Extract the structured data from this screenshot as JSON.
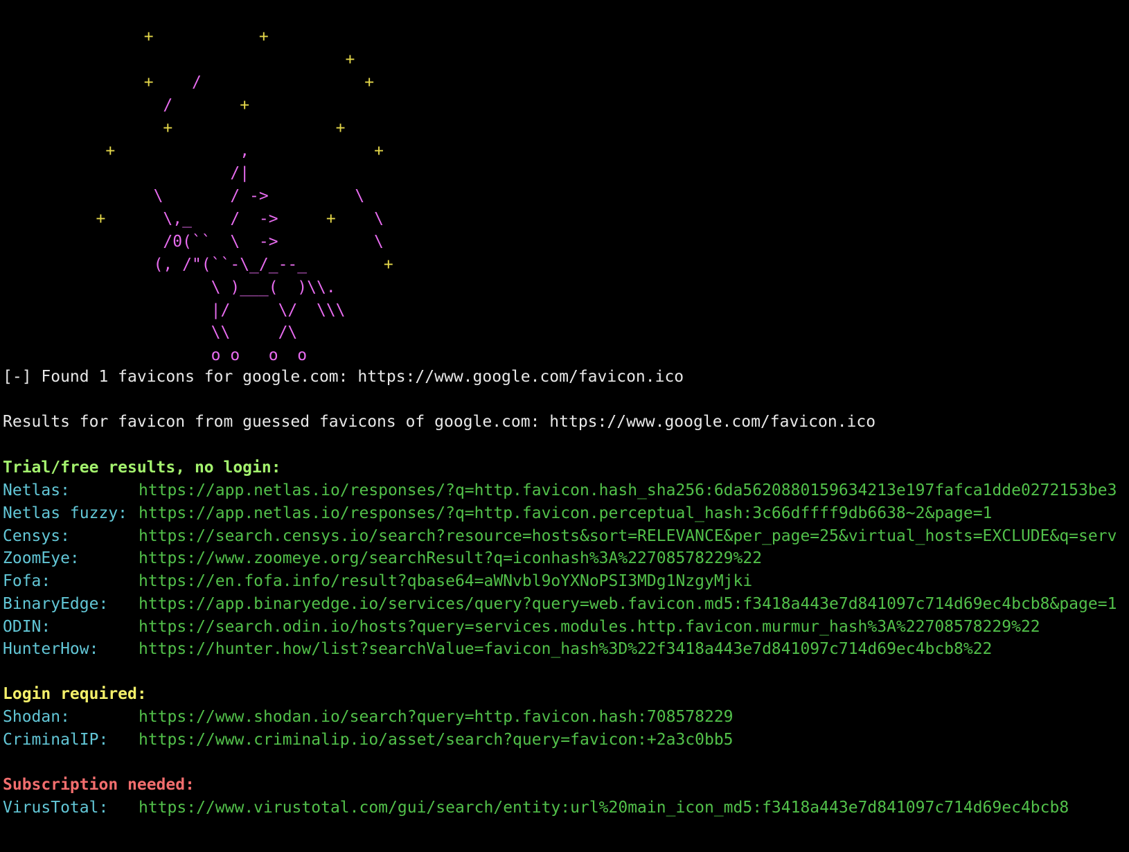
{
  "colors": {
    "background": "#000000",
    "star": "#e5d84a",
    "art": "#e86cf0",
    "text": "#e8e8e8",
    "label": "#62c6d6",
    "url": "#52c04a",
    "header_trial": "#a4f26e",
    "header_login": "#f4f06a",
    "header_subscription": "#f26e6e"
  },
  "ascii_art": {
    "lines": [
      {
        "star": "         +           +",
        "art": ""
      },
      {
        "star": "                              +",
        "art": ""
      },
      {
        "star": "         +    ",
        "art": "/",
        "star2": "                 +"
      },
      {
        "star": "",
        "art": "           /",
        "star2": "       +"
      },
      {
        "star": "           +                 +",
        "art": ""
      },
      {
        "star": "     +",
        "art": "             ,",
        "star2": "             +"
      },
      {
        "star": "",
        "art": "                  /|",
        "star2": ""
      },
      {
        "star": "",
        "art": "          \\       / ->         \\",
        "star2": ""
      },
      {
        "star": "    +",
        "art": "      \\,_    /  ->",
        "star2": "     +    ",
        "art2": "\\"
      },
      {
        "star": "",
        "art": "           /0(``  \\  ->          \\",
        "star2": ""
      },
      {
        "star": "",
        "art": "          (, /\"(``-\\_/_--_",
        "star2": "        +"
      },
      {
        "star": "",
        "art": "                \\ )___(  )\\\\.",
        "star2": ""
      },
      {
        "star": "",
        "art": "                |/     \\/  \\\\\\",
        "star2": ""
      },
      {
        "star": "",
        "art": "                \\\\     /\\",
        "star2": ""
      },
      {
        "star": "",
        "art": "                o o   o  o",
        "star2": ""
      }
    ]
  },
  "found_line": "[-] Found 1 favicons for google.com: https://www.google.com/favicon.ico",
  "results_line": "Results for favicon from guessed favicons of google.com: https://www.google.com/favicon.ico",
  "sections": [
    {
      "header": "Trial/free results, no login:",
      "entries": [
        {
          "label": "Netlas:",
          "url": "https://app.netlas.io/responses/?q=http.favicon.hash_sha256:6da5620880159634213e197fafca1dde0272153be3"
        },
        {
          "label": "Netlas fuzzy:",
          "url": "https://app.netlas.io/responses/?q=http.favicon.perceptual_hash:3c66dffff9db6638~2&page=1"
        },
        {
          "label": "Censys:",
          "url": "https://search.censys.io/search?resource=hosts&sort=RELEVANCE&per_page=25&virtual_hosts=EXCLUDE&q=serv"
        },
        {
          "label": "ZoomEye:",
          "url": "https://www.zoomeye.org/searchResult?q=iconhash%3A%22708578229%22"
        },
        {
          "label": "Fofa:",
          "url": "https://en.fofa.info/result?qbase64=aWNvbl9oYXNoPSI3MDg1NzgyMjki"
        },
        {
          "label": "BinaryEdge:",
          "url": "https://app.binaryedge.io/services/query?query=web.favicon.md5:f3418a443e7d841097c714d69ec4bcb8&page=1"
        },
        {
          "label": "ODIN:",
          "url": "https://search.odin.io/hosts?query=services.modules.http.favicon.murmur_hash%3A%22708578229%22"
        },
        {
          "label": "HunterHow:",
          "url": "https://hunter.how/list?searchValue=favicon_hash%3D%22f3418a443e7d841097c714d69ec4bcb8%22"
        }
      ]
    },
    {
      "header": "Login required:",
      "entries": [
        {
          "label": "Shodan:",
          "url": "https://www.shodan.io/search?query=http.favicon.hash:708578229"
        },
        {
          "label": "CriminalIP:",
          "url": "https://www.criminalip.io/asset/search?query=favicon:+2a3c0bb5"
        }
      ]
    },
    {
      "header": "Subscription needed:",
      "entries": [
        {
          "label": "VirusTotal:",
          "url": "https://www.virustotal.com/gui/search/entity:url%20main_icon_md5:f3418a443e7d841097c714d69ec4bcb8"
        }
      ]
    }
  ]
}
